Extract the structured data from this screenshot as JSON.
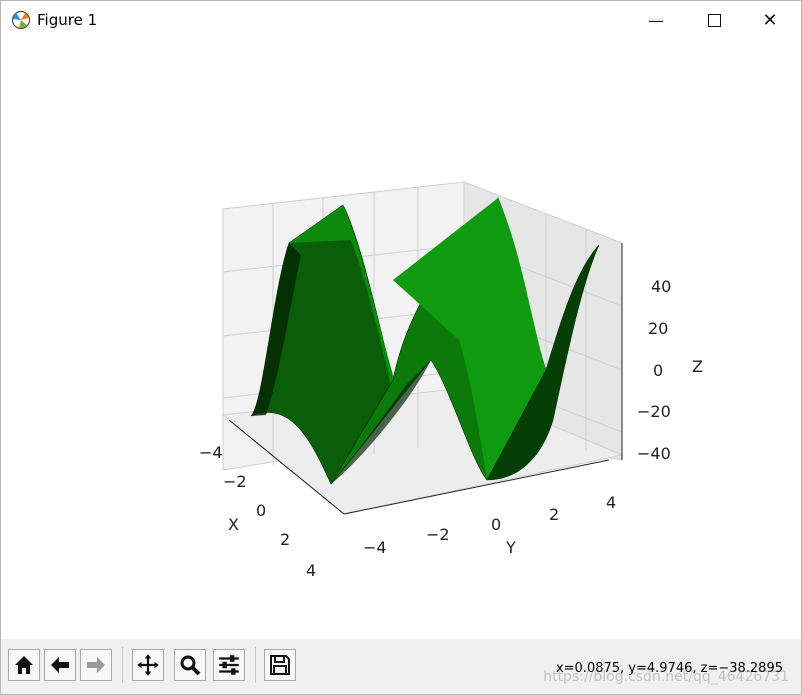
{
  "window": {
    "title": "Figure 1"
  },
  "plot": {
    "x_ticks": [
      "−4",
      "−2",
      "0",
      "2",
      "4"
    ],
    "y_ticks": [
      "−4",
      "−2",
      "0",
      "2",
      "4"
    ],
    "z_ticks": [
      "40",
      "20",
      "0",
      "−20",
      "−40"
    ],
    "x_label": "X",
    "y_label": "Y",
    "z_label": "Z",
    "surface_color": "#008000"
  },
  "toolbar": {
    "items": [
      {
        "name": "home",
        "icon": "home-icon"
      },
      {
        "name": "back",
        "icon": "back-arrow-icon"
      },
      {
        "name": "forward",
        "icon": "forward-arrow-icon"
      },
      {
        "name": "pan",
        "icon": "move-icon"
      },
      {
        "name": "zoom",
        "icon": "magnifier-icon"
      },
      {
        "name": "configure",
        "icon": "sliders-icon"
      },
      {
        "name": "save",
        "icon": "floppy-disk-icon"
      }
    ],
    "coordinates": "x=0.0875, y=4.9746, z=−38.2895",
    "watermark": "https://blog.csdn.net/qq_46426731"
  }
}
